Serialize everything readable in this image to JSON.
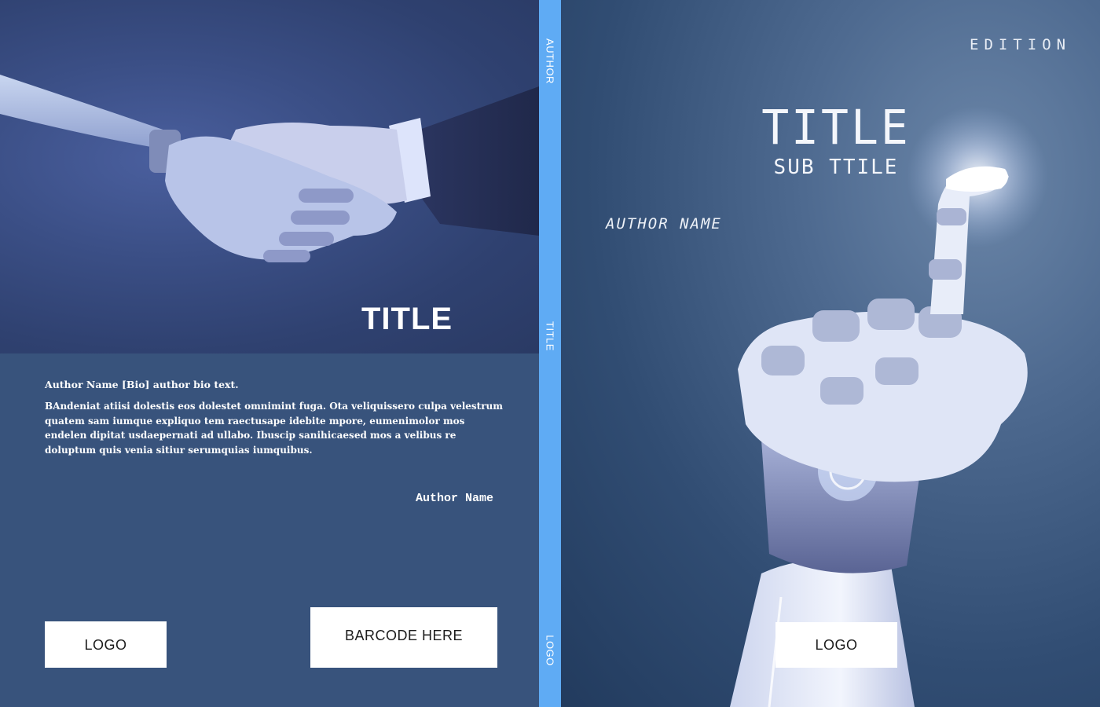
{
  "back_cover": {
    "title": "TITLE",
    "bio_heading": "Author Name [Bio] author bio text.",
    "bio_text": "BAndeniat atiisi dolestis eos dolestet omnimint fuga. Ota veliquissero culpa velestrum quatem sam iumque expliquo tem raectusape idebite mpore, eumenimolor mos endelen dipitat usdaepernati ad ullabo. Ibuscip sanihicaesed mos a velibus re doluptum quis venia sitiur serumquias iumquibus.",
    "author_name": "Author Name",
    "logo_label": "LOGO",
    "barcode_label": "BARCODE HERE"
  },
  "spine": {
    "author": "AUTHOR",
    "title": "TITLE",
    "logo": "LOGO"
  },
  "front_cover": {
    "edition": "EDITION",
    "title": "TITLE",
    "subtitle": "SUB TTILE",
    "author_name": "AUTHOR NAME",
    "logo_label": "LOGO"
  },
  "colors": {
    "back_panel": "#38537c",
    "spine": "#5fabf4",
    "front_background": "#314d73",
    "label_box": "#ffffff"
  },
  "icons": [
    "handshake-robot-human-image",
    "robot-hand-pointing-image"
  ]
}
